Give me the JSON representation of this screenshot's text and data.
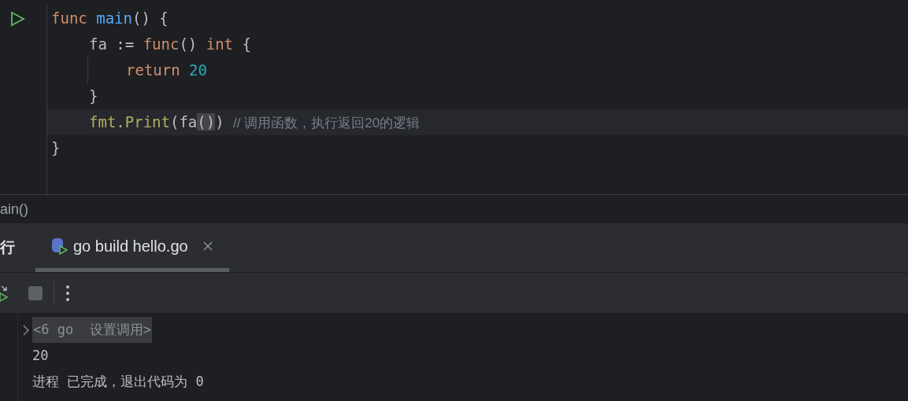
{
  "editor": {
    "lines": [
      {
        "run_marker": true,
        "current": false,
        "tokens": [
          {
            "text": "func ",
            "kind": "keyword"
          },
          {
            "text": "main",
            "kind": "function"
          },
          {
            "text": "() {",
            "kind": "plain"
          }
        ],
        "children": [
          {
            "current": false,
            "tokens": [
              {
                "text": "fa := ",
                "kind": "plain"
              },
              {
                "text": "func",
                "kind": "keyword"
              },
              {
                "text": "() ",
                "kind": "plain"
              },
              {
                "text": "int",
                "kind": "keyword"
              },
              {
                "text": " {",
                "kind": "plain"
              }
            ],
            "children": [
              {
                "current": false,
                "tokens": [
                  {
                    "text": "return ",
                    "kind": "keyword"
                  },
                  {
                    "text": "20",
                    "kind": "number"
                  }
                ]
              }
            ]
          },
          {
            "current": false,
            "tokens": [
              {
                "text": "}",
                "kind": "plain"
              }
            ]
          },
          {
            "current": true,
            "tokens": [
              {
                "text": "fmt.Print",
                "kind": "call"
              },
              {
                "text": "(fa",
                "kind": "plain"
              },
              {
                "text": "()",
                "kind": "matched"
              },
              {
                "text": ") ",
                "kind": "plain"
              },
              {
                "text": "// 调用函数，执行返回20的逻辑",
                "kind": "comment"
              }
            ]
          }
        ]
      },
      {
        "current": false,
        "tokens": [
          {
            "text": "}",
            "kind": "plain"
          }
        ]
      }
    ]
  },
  "breadcrumb": "ain()",
  "run_panel": {
    "title": "行",
    "tabs": [
      {
        "label": "go build hello.go",
        "selected": true
      }
    ]
  },
  "console": {
    "lines": [
      {
        "kind": "folded",
        "text": "<6 go  设置调用>"
      },
      {
        "kind": "output",
        "text": "20"
      },
      {
        "kind": "output",
        "text": "进程 已完成，退出代码为 0"
      }
    ]
  }
}
